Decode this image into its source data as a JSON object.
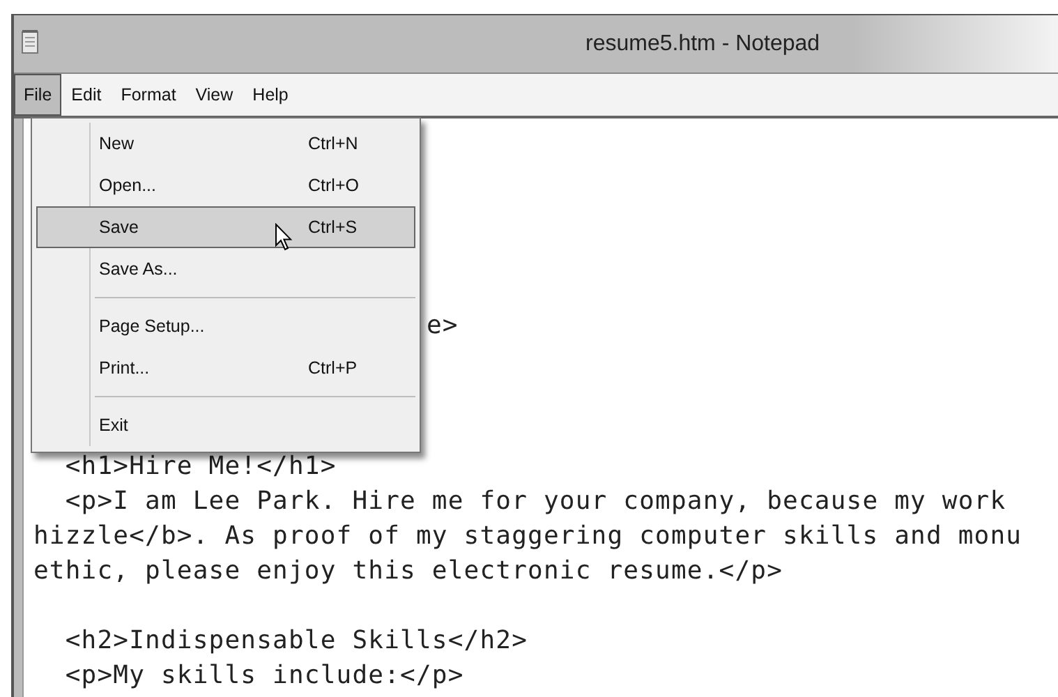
{
  "window": {
    "title": "resume5.htm - Notepad"
  },
  "menu_bar": [
    {
      "label": "File",
      "selected": true
    },
    {
      "label": "Edit",
      "selected": false
    },
    {
      "label": "Format",
      "selected": false
    },
    {
      "label": "View",
      "selected": false
    },
    {
      "label": "Help",
      "selected": false
    }
  ],
  "file_menu": {
    "items": [
      {
        "kind": "item",
        "label": "New",
        "shortcut": "Ctrl+N",
        "selected": false
      },
      {
        "kind": "item",
        "label": "Open...",
        "shortcut": "Ctrl+O",
        "selected": false
      },
      {
        "kind": "item",
        "label": "Save",
        "shortcut": "Ctrl+S",
        "selected": true
      },
      {
        "kind": "item",
        "label": "Save As...",
        "selected": false
      },
      {
        "kind": "separator"
      },
      {
        "kind": "item",
        "label": "Page Setup...",
        "selected": false
      },
      {
        "kind": "item",
        "label": "Print...",
        "shortcut": "Ctrl+P",
        "selected": false
      },
      {
        "kind": "separator"
      },
      {
        "kind": "item",
        "label": "Exit",
        "selected": false
      }
    ]
  },
  "editor": {
    "lines": [
      {
        "kind": "tail",
        "text": "e>"
      },
      {
        "kind": "code",
        "text": "  <h1>Hire Me!</h1>"
      },
      {
        "kind": "code",
        "text": "  <p>I am Lee Park. Hire me for your company, because my work"
      },
      {
        "kind": "code",
        "text": "hizzle</b>. As proof of my staggering computer skills and monu"
      },
      {
        "kind": "code",
        "text": "ethic, please enjoy this electronic resume.</p>"
      },
      {
        "kind": "blank"
      },
      {
        "kind": "code",
        "text": "  <h2>Indispensable Skills</h2>"
      },
      {
        "kind": "code",
        "text": "  <p>My skills include:</p>"
      }
    ]
  }
}
